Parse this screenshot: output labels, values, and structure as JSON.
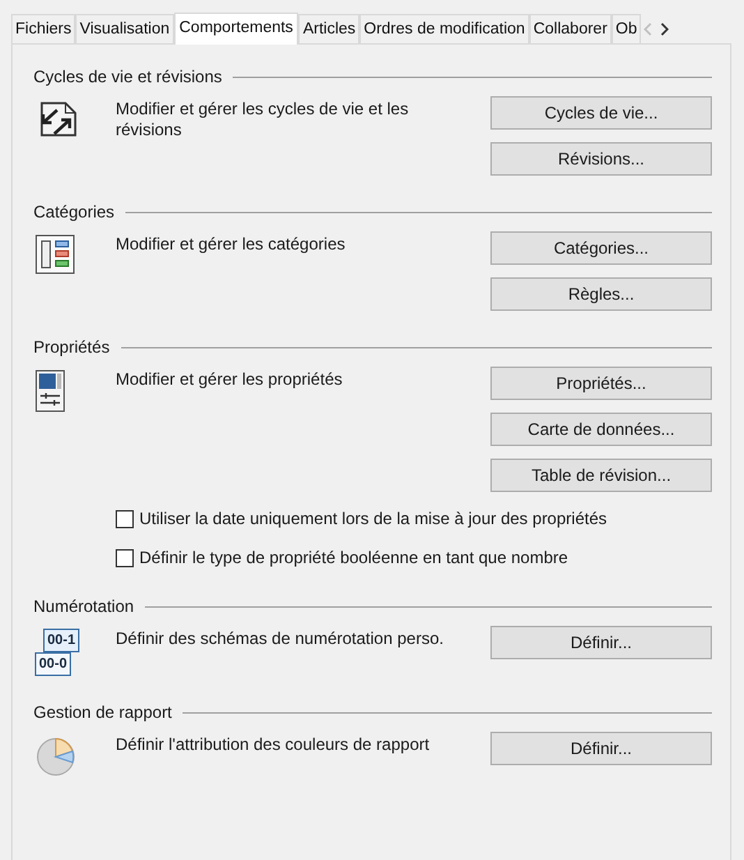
{
  "tabs": [
    {
      "label": "Fichiers",
      "selected": false
    },
    {
      "label": "Visualisation",
      "selected": false
    },
    {
      "label": "Comportements",
      "selected": true
    },
    {
      "label": "Articles",
      "selected": false
    },
    {
      "label": "Ordres de modification",
      "selected": false
    },
    {
      "label": "Collaborer",
      "selected": false
    },
    {
      "label": "Ob",
      "selected": false
    }
  ],
  "tab_scroll": {
    "left_disabled": true,
    "right_disabled": false
  },
  "sections": [
    {
      "title": "Cycles de vie et révisions",
      "kind": "lifecycle",
      "description": "Modifier et gérer les cycles de vie et les révisions",
      "buttons": [
        "Cycles de vie...",
        "Révisions..."
      ]
    },
    {
      "title": "Catégories",
      "kind": "categories",
      "description": "Modifier et gérer les catégories",
      "buttons": [
        "Catégories...",
        "Règles..."
      ]
    },
    {
      "title": "Propriétés",
      "kind": "properties",
      "description": "Modifier et gérer les propriétés",
      "buttons": [
        "Propriétés...",
        "Carte de données...",
        "Table de révision..."
      ],
      "checkboxes": [
        {
          "label": "Utiliser la date uniquement lors de la mise à jour des propriétés",
          "checked": false
        },
        {
          "label": "Définir le type de propriété booléenne en tant que nombre",
          "checked": false
        }
      ]
    },
    {
      "title": "Numérotation",
      "kind": "numbering",
      "icon_texts": [
        "00-1",
        "00-0"
      ],
      "description": "Définir des schémas de numérotation perso.",
      "buttons": [
        "Définir..."
      ]
    },
    {
      "title": "Gestion de rapport",
      "kind": "report",
      "description": "Définir l'attribution des couleurs de rapport",
      "buttons": [
        "Définir..."
      ]
    }
  ]
}
